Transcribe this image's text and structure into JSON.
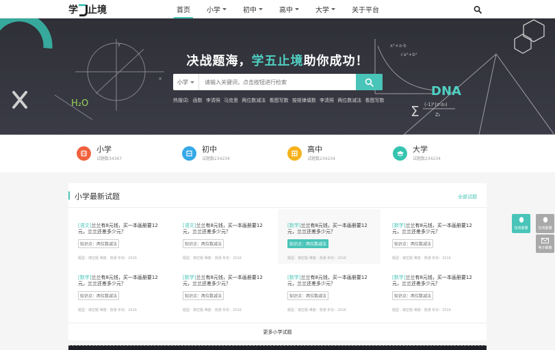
{
  "nav": {
    "logo": {
      "pre": "学",
      "post": "止境"
    },
    "items": [
      {
        "label": "首页",
        "active": true,
        "dropdown": false
      },
      {
        "label": "小学",
        "dropdown": true
      },
      {
        "label": "初中",
        "dropdown": true
      },
      {
        "label": "高中",
        "dropdown": true
      },
      {
        "label": "大学",
        "dropdown": true
      },
      {
        "label": "关于平台",
        "dropdown": false
      }
    ]
  },
  "hero": {
    "title_pre": "决战题海，",
    "title_highlight": "学五止境",
    "title_post": "助你成功！",
    "select_value": "小学",
    "search_placeholder": "请输入关键词，点击按钮进行检索",
    "hot_label": "热搜词:",
    "hot_words": [
      "函数",
      "李清照",
      "马克思",
      "两位数减法",
      "看图写数",
      "按规律填数",
      "李清照",
      "两位数减法",
      "看图写数"
    ],
    "deco_text": {
      "h2o": "H₂O",
      "dna": "DNA",
      "formula": "(-1)ᵏ(z-z₀)",
      "zk": "Zₖ"
    }
  },
  "categories": [
    {
      "name": "小学",
      "count": "试题数34367",
      "color": "#f0603c"
    },
    {
      "name": "初中",
      "count": "试题数234234",
      "color": "#35a9e8"
    },
    {
      "name": "高中",
      "count": "试题数234234",
      "color": "#f6b21c"
    },
    {
      "name": "大学",
      "count": "试题数234234",
      "color": "#35c4b0"
    }
  ],
  "panel": {
    "title": "小学最新试题",
    "all_link": "全部试题",
    "more": "更多小学试题",
    "questions": [
      {
        "subject": "[语文]",
        "text": "兰兰有8元钱，买一本画册要12元，兰兰还差多少元？",
        "tag": "知识点：两位数减法",
        "meta": "题型：填空题   难度：普通   年份：2016"
      },
      {
        "subject": "[语文]",
        "text": "兰兰有8元钱，买一本画册要12元，兰兰还差多少元？",
        "tag": "知识点：两位数减法",
        "meta": "题型：填空题   难度：普通   年份：2016"
      },
      {
        "subject": "[数学]",
        "text": "兰兰有8元钱，买一本画册要12元，兰兰还差多少元？",
        "tag": "知识点：两位数减法",
        "meta": "题型：填空题   难度：普通   年份：2016"
      },
      {
        "subject": "[数学]",
        "text": "兰兰有8元钱，买一本画册要12元，兰兰还差多少元？",
        "tag": "知识点：两位数减法",
        "meta": "题型：填空题   难度：普通   年份：2016"
      },
      {
        "subject": "[数学]",
        "text": "兰兰有8元钱，买一本画册要12元，兰兰还差多少元？",
        "tag": "知识点：两位数减法",
        "meta": "题型：填空题   难度：普通   年份：2016"
      },
      {
        "subject": "[数学]",
        "text": "兰兰有8元钱，买一本画册要12元，兰兰还差多少元？",
        "tag": "知识点：两位数减法",
        "meta": "题型：填空题   难度：普通   年份：2016"
      },
      {
        "subject": "[数学]",
        "text": "兰兰有8元钱，买一本画册要12元，兰兰还差多少元？",
        "tag": "知识点：两位数减法",
        "meta": "题型：填空题   难度：普通   年份：2016"
      },
      {
        "subject": "[数学]",
        "text": "兰兰有8元钱，买一本画册要12元，兰兰还差多少元？",
        "tag": "知识点：两位数减法",
        "meta": "题型：填空题   难度：普通   年份：2016"
      }
    ]
  },
  "side": {
    "service1": "在线客服",
    "service2": "在线客服",
    "email": "电子邮箱"
  },
  "colors": {
    "accent": "#49c4b8",
    "hero_bg": "#33343d"
  }
}
